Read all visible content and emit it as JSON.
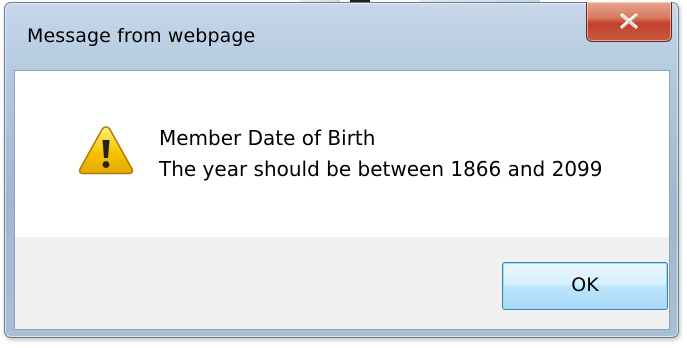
{
  "dialog": {
    "title": "Message from webpage",
    "close_glyph": "x",
    "icon": "warning-icon",
    "message_lines": [
      "Member Date of Birth",
      "The year should be between 1866 and 2099"
    ],
    "ok_label": "OK"
  },
  "colors": {
    "frame": "#b3c9df",
    "close_button": "#c1412a",
    "ok_button_border": "#3c7fb1",
    "footer": "#f0f0f0",
    "warning_fill": "#f5c400"
  }
}
